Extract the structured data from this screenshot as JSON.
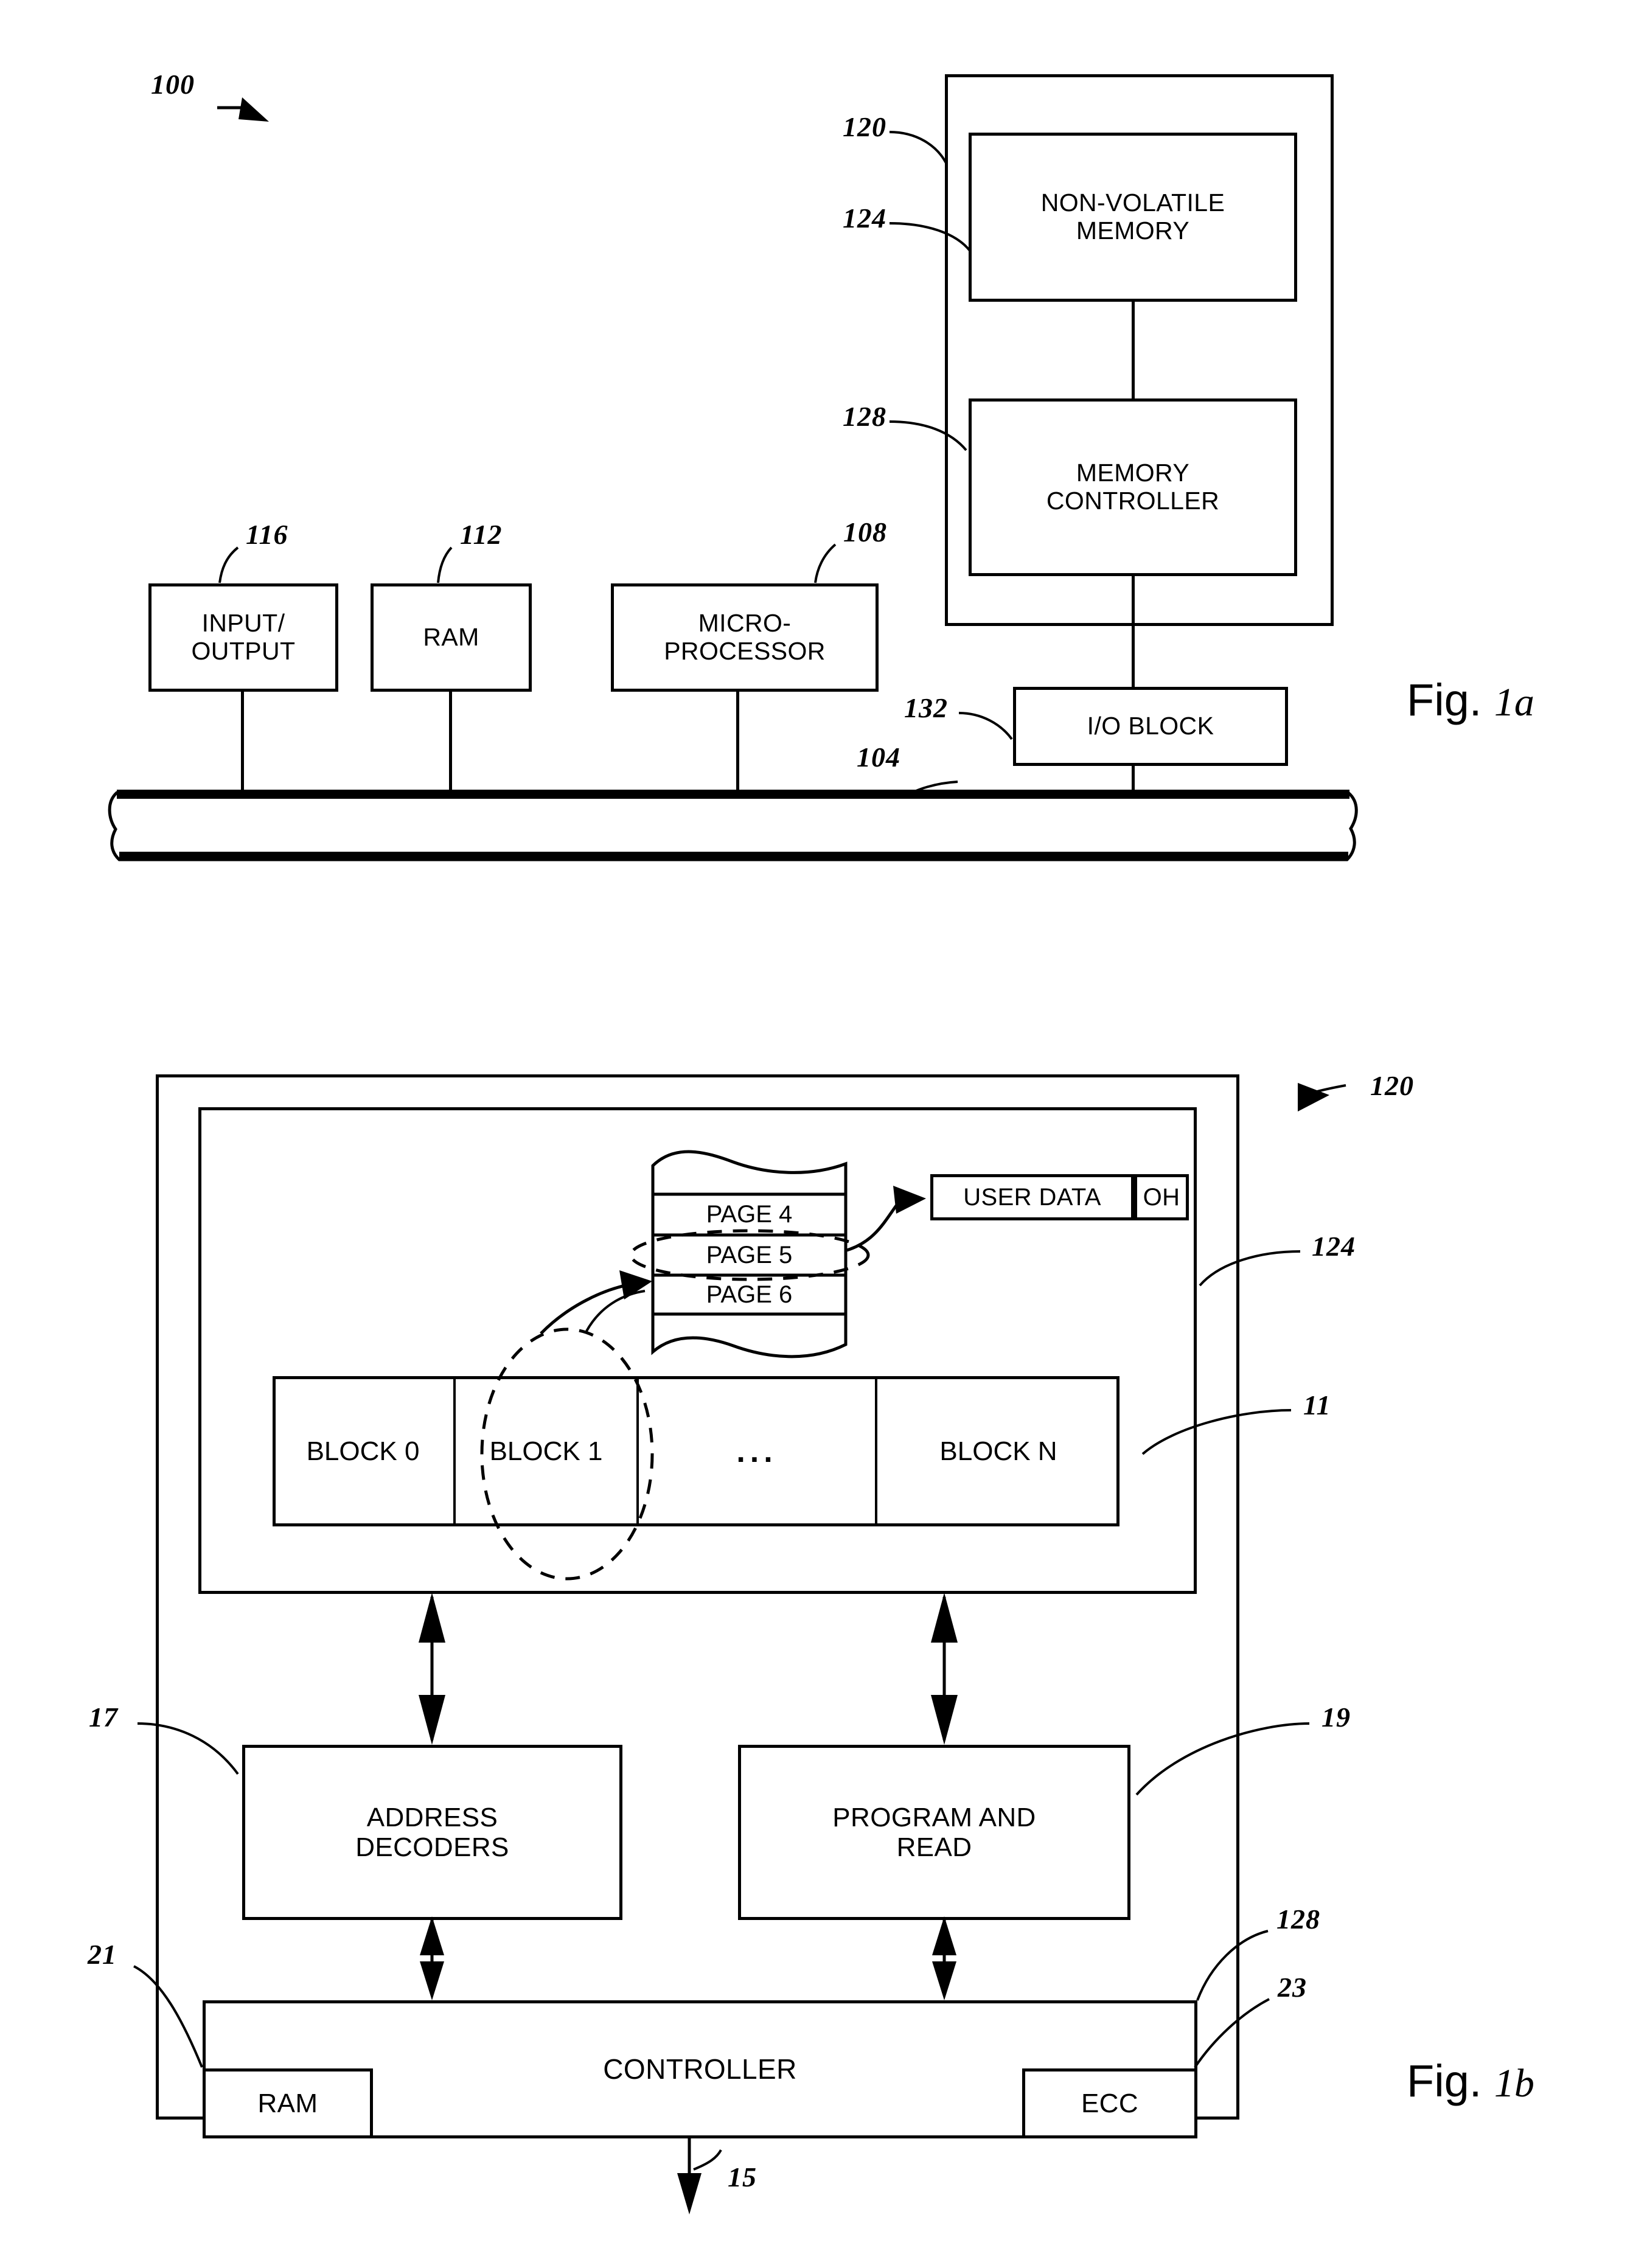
{
  "figures": [
    {
      "id": "fig-1a",
      "caption_word": "Fig.",
      "caption_num": "1a",
      "system_ref": "100",
      "blocks": [
        {
          "name": "non-volatile-memory",
          "label": "NON-VOLATILE\nMEMORY",
          "ref": "124"
        },
        {
          "name": "memory-controller",
          "label": "MEMORY\nCONTROLLER",
          "ref": "128"
        },
        {
          "name": "io-block",
          "label": "I/O BLOCK",
          "ref": "132"
        },
        {
          "name": "input-output",
          "label": "INPUT/\nOUTPUT",
          "ref": "116"
        },
        {
          "name": "ram",
          "label": "RAM",
          "ref": "112"
        },
        {
          "name": "microprocessor",
          "label": "MICRO-\nPROCESSOR",
          "ref": "108"
        }
      ],
      "memory_package_ref": "120",
      "bus_ref": "104"
    },
    {
      "id": "fig-1b",
      "caption_word": "Fig.",
      "caption_num": "1b",
      "device_ref": "120",
      "array_ref": "124",
      "blocks_row_ref": "11",
      "pages": [
        "PAGE 4",
        "PAGE 5",
        "PAGE 6"
      ],
      "page_fields": [
        {
          "label": "USER  DATA",
          "name": "user-data-field"
        },
        {
          "label": "OH",
          "name": "overhead-field"
        }
      ],
      "memory_blocks": [
        "BLOCK 0",
        "BLOCK 1",
        "...",
        "BLOCK N"
      ],
      "blocks": [
        {
          "name": "address-decoders",
          "label": "ADDRESS\nDECODERS",
          "ref": "17"
        },
        {
          "name": "program-and-read",
          "label": "PROGRAM AND\nREAD",
          "ref": "19"
        },
        {
          "name": "controller",
          "label": "CONTROLLER",
          "ref": "128"
        },
        {
          "name": "controller-ram",
          "label": "RAM",
          "ref": "21"
        },
        {
          "name": "controller-ecc",
          "label": "ECC",
          "ref": "23"
        }
      ],
      "host_interface_ref": "15"
    }
  ]
}
